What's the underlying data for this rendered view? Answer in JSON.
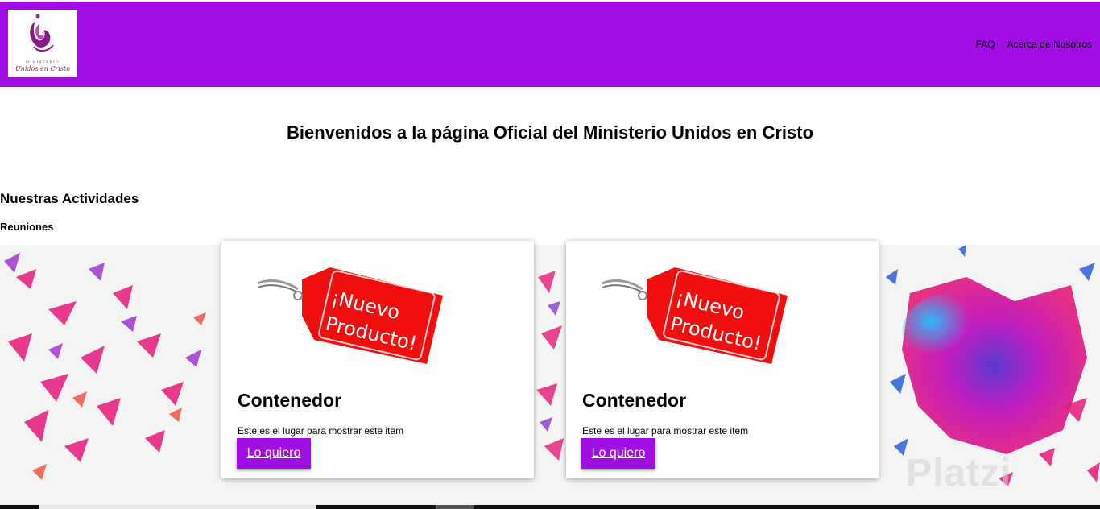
{
  "header": {
    "logo": {
      "top_text": "MINISTERIO",
      "script_text": "Unidos en Cristo"
    },
    "nav": [
      {
        "label": "FAQ"
      },
      {
        "label": "Acerca de Nosotros"
      }
    ],
    "bg_color": "#a10ee3"
  },
  "main": {
    "title": "Bienvenidos a la página Oficial del Ministerio Unidos en Cristo",
    "section_title": "Nuestras Actividades",
    "subsection_title": "Reuniones"
  },
  "cards": [
    {
      "tag_line1": "¡Nuevo",
      "tag_line2": "Producto!",
      "title": "Contenedor",
      "description": "Este es el lugar para mostrar este item",
      "button_label": "Lo quiero"
    },
    {
      "tag_line1": "¡Nuevo",
      "tag_line2": "Producto!",
      "title": "Contenedor",
      "description": "Este es el lugar para mostrar este item",
      "button_label": "Lo quiero"
    }
  ],
  "watermark": "Platzi",
  "colors": {
    "accent": "#a10ee3",
    "tag_red": "#f00e0e",
    "splash_pink": "#e6197a",
    "splash_blue": "#2a5fd8"
  }
}
